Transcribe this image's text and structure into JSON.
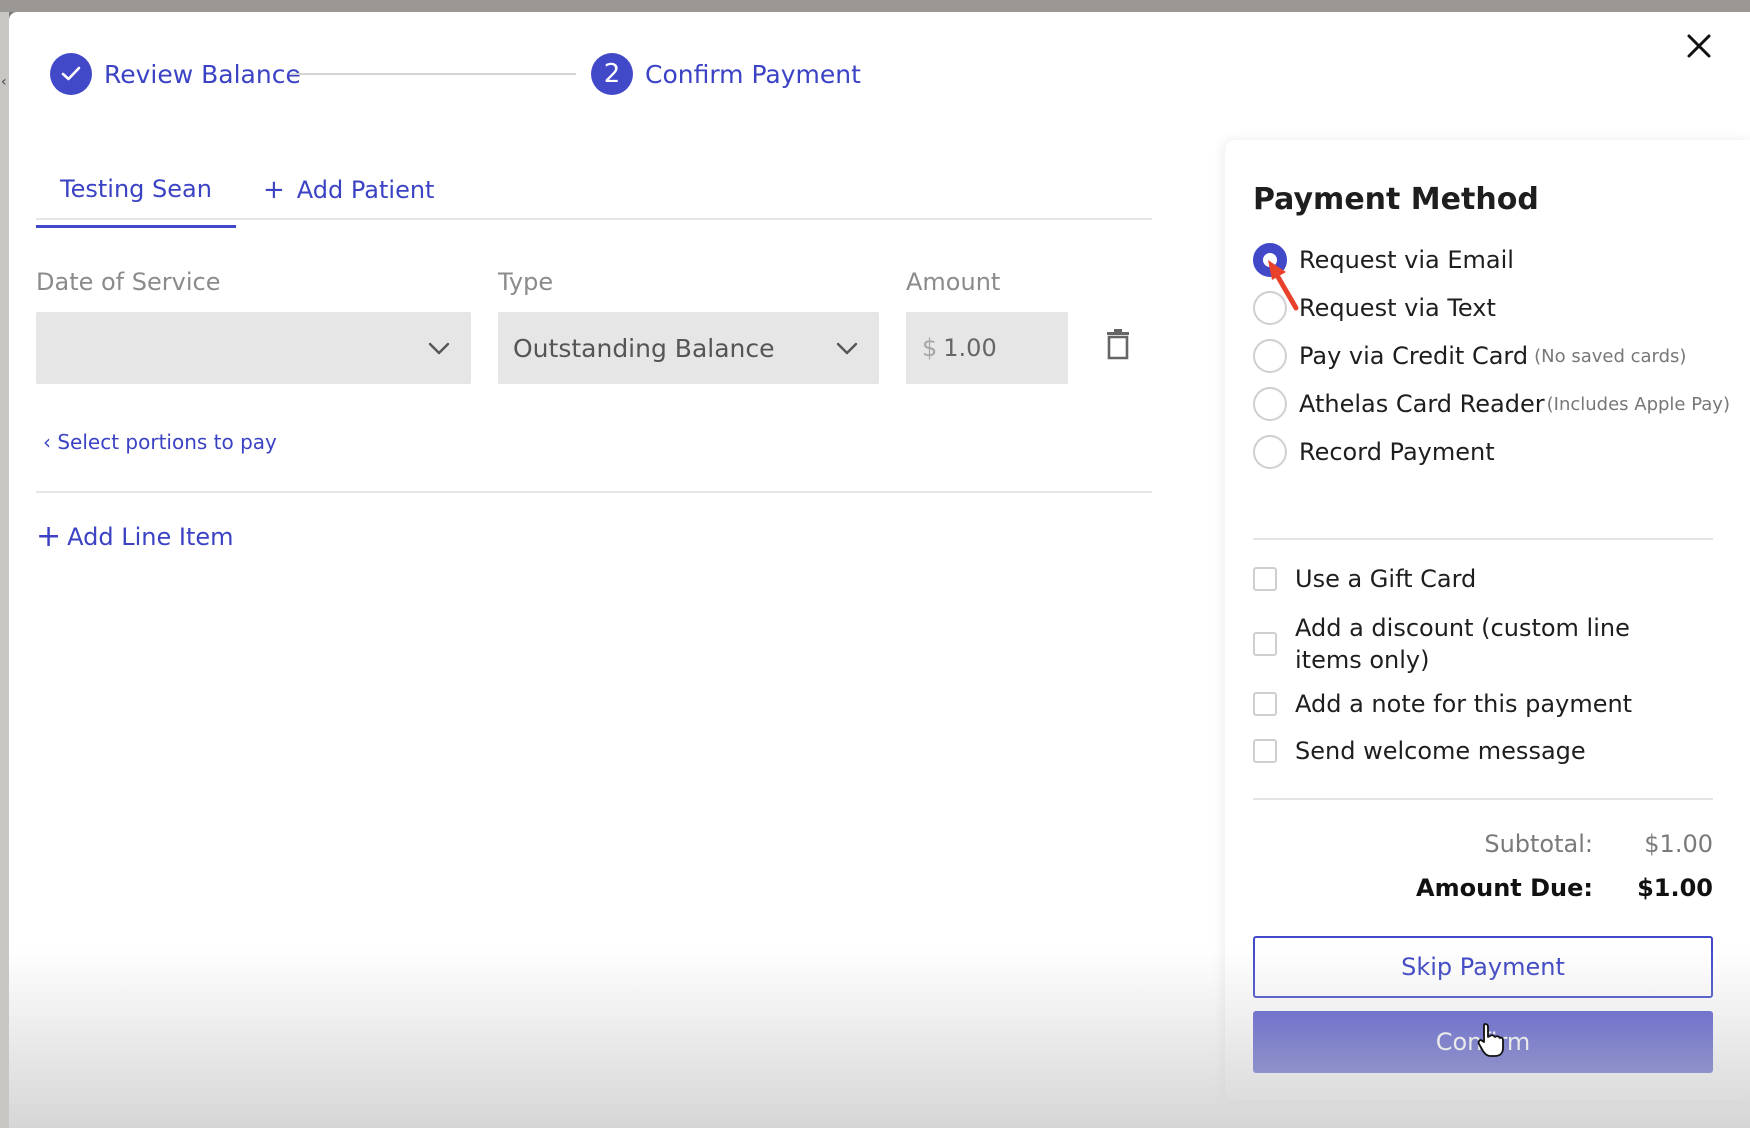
{
  "stepper": {
    "steps": [
      {
        "label": "Review Balance",
        "status": "complete",
        "icon": "check-icon"
      },
      {
        "label": "Confirm Payment",
        "status": "active",
        "number": "2"
      }
    ]
  },
  "tabs": {
    "active_label": "Testing Sean",
    "add_label": "Add Patient"
  },
  "line_item": {
    "date_label": "Date of Service",
    "date_value": "",
    "type_label": "Type",
    "type_value": "Outstanding Balance",
    "amount_label": "Amount",
    "currency_symbol": "$",
    "amount_value": "1.00"
  },
  "links": {
    "select_portions": "Select portions to pay",
    "add_line_item": "Add Line Item"
  },
  "payment": {
    "title": "Payment Method",
    "methods": [
      {
        "label": "Request via Email",
        "note": "",
        "checked": true
      },
      {
        "label": "Request via Text",
        "note": "",
        "checked": false
      },
      {
        "label": "Pay via Credit Card",
        "note": "(No saved cards)",
        "checked": false
      },
      {
        "label": "Athelas Card Reader",
        "note": "(Includes Apple Pay)",
        "checked": false
      },
      {
        "label": "Record Payment",
        "note": "",
        "checked": false
      }
    ],
    "options": [
      {
        "label": "Use a Gift Card"
      },
      {
        "label": "Add a discount (custom line items only)"
      },
      {
        "label": "Add a note for this payment"
      },
      {
        "label": "Send welcome message"
      }
    ],
    "subtotal_label": "Subtotal:",
    "subtotal_value": "$1.00",
    "amount_due_label": "Amount Due:",
    "amount_due_value": "$1.00",
    "skip_label": "Skip Payment",
    "confirm_label": "Confirm"
  },
  "colors": {
    "accent": "#4149c9",
    "confirm_bg": "#5256cc",
    "annotation_arrow": "#e8412c"
  }
}
